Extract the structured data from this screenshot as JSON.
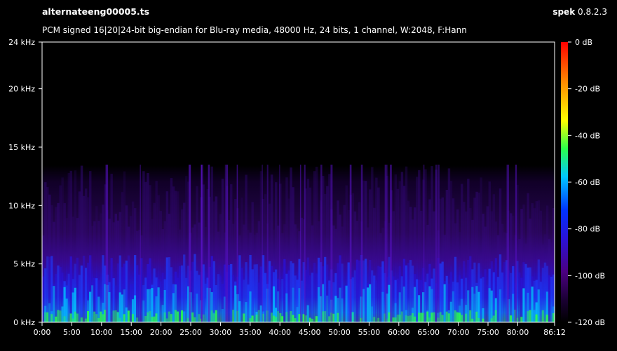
{
  "header": {
    "file_name": "alternateeng00005.ts",
    "stream_info": "PCM signed 16|20|24-bit big-endian for Blu-ray media, 48000 Hz, 24 bits, 1 channel, W:2048, F:Hann",
    "app_name": "spek",
    "app_version": "0.8.2.3"
  },
  "colors": {
    "background": "#000000",
    "axis": "#ffffff",
    "palette": [
      "#000000",
      "#1a0033",
      "#4b0082",
      "#2a12d8",
      "#0033ff",
      "#00c8ff",
      "#2bff4a",
      "#ffff00",
      "#ff8800",
      "#ff0000"
    ]
  },
  "chart_data": {
    "type": "heatmap",
    "title": "",
    "xlabel": "",
    "ylabel": "",
    "x_ticks": [
      "0:00",
      "5:00",
      "10:00",
      "15:00",
      "20:00",
      "25:00",
      "30:00",
      "35:00",
      "40:00",
      "45:00",
      "50:00",
      "55:00",
      "60:00",
      "65:00",
      "70:00",
      "75:00",
      "80:00",
      "86:12"
    ],
    "x_range_minutes": [
      0,
      86.2
    ],
    "y_ticks": [
      "0 kHz",
      "5 kHz",
      "10 kHz",
      "15 kHz",
      "20 kHz",
      "24 kHz"
    ],
    "y_range_khz": [
      0,
      24
    ],
    "colorbar_ticks": [
      "0 dB",
      "-20 dB",
      "-40 dB",
      "-60 dB",
      "-80 dB",
      "-100 dB",
      "-120 dB"
    ],
    "colorbar_range_db": [
      -120,
      0
    ],
    "approx_upper_content_khz": 13.5,
    "approx_dense_content_khz": 4.5
  }
}
